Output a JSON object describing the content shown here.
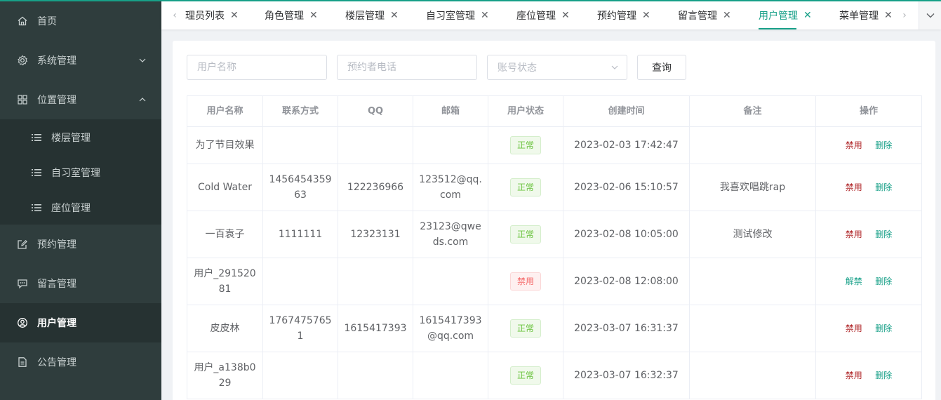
{
  "sidebar": {
    "items": [
      {
        "label": "首页",
        "icon": "home-icon"
      },
      {
        "label": "系统管理",
        "icon": "gear-icon"
      },
      {
        "label": "位置管理",
        "icon": "grid-icon"
      },
      {
        "label": "预约管理",
        "icon": "edit-icon"
      },
      {
        "label": "留言管理",
        "icon": "message-icon"
      },
      {
        "label": "用户管理",
        "icon": "user-icon"
      },
      {
        "label": "公告管理",
        "icon": "document-icon"
      }
    ],
    "subitems": [
      {
        "label": "楼层管理",
        "icon": "list-icon"
      },
      {
        "label": "自习室管理",
        "icon": "list-icon"
      },
      {
        "label": "座位管理",
        "icon": "list-icon"
      }
    ]
  },
  "tabs": [
    {
      "label": "理员列表"
    },
    {
      "label": "角色管理"
    },
    {
      "label": "楼层管理"
    },
    {
      "label": "自习室管理"
    },
    {
      "label": "座位管理"
    },
    {
      "label": "预约管理"
    },
    {
      "label": "留言管理"
    },
    {
      "label": "用户管理",
      "active": true
    },
    {
      "label": "菜单管理"
    }
  ],
  "filters": {
    "username_placeholder": "用户名称",
    "phone_placeholder": "预约者电话",
    "status_placeholder": "账号状态",
    "query_label": "查询"
  },
  "table": {
    "headers": [
      "用户名称",
      "联系方式",
      "QQ",
      "邮箱",
      "用户状态",
      "创建时间",
      "备注",
      "操作"
    ],
    "rows": [
      {
        "name": "为了节目效果",
        "phone": "",
        "qq": "",
        "email": "",
        "status": "正常",
        "created": "2023-02-03 17:42:47",
        "note": "",
        "toggle": "禁用",
        "delete": "删除"
      },
      {
        "name": "Cold Water",
        "phone": "145645435963",
        "qq": "122236966",
        "email": "123512@qq.com",
        "status": "正常",
        "created": "2023-02-06 15:10:57",
        "note": "我喜欢唱跳rap",
        "toggle": "禁用",
        "delete": "删除"
      },
      {
        "name": "一百袁子",
        "phone": "1111111",
        "qq": "12323131",
        "email": "23123@qweds.com",
        "status": "正常",
        "created": "2023-02-08 10:05:00",
        "note": "测试修改",
        "toggle": "禁用",
        "delete": "删除"
      },
      {
        "name": "用户_29152081",
        "phone": "",
        "qq": "",
        "email": "",
        "status": "禁用",
        "created": "2023-02-08 12:08:00",
        "note": "",
        "toggle": "解禁",
        "delete": "删除"
      },
      {
        "name": "皮皮林",
        "phone": "17674757651",
        "qq": "1615417393",
        "email": "1615417393@qq.com",
        "status": "正常",
        "created": "2023-03-07 16:31:37",
        "note": "",
        "toggle": "禁用",
        "delete": "删除"
      },
      {
        "name": "用户_a138b029",
        "phone": "",
        "qq": "",
        "email": "",
        "status": "正常",
        "created": "2023-03-07 16:32:37",
        "note": "",
        "toggle": "禁用",
        "delete": "删除"
      }
    ]
  },
  "colors": {
    "accent": "#17a088",
    "sidebar_bg": "#2f3d3d",
    "status_ok": "#67c23a",
    "status_ban": "#f56c6c",
    "action_red": "#b0272a"
  }
}
